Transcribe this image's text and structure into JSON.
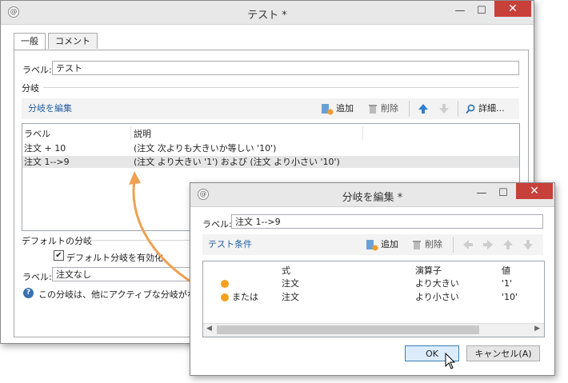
{
  "main": {
    "title": "テスト *",
    "tabs": [
      "一般",
      "コメント"
    ],
    "label_caption": "ラベル:",
    "label_value": "テスト",
    "branch_section": "分岐",
    "toolbar": {
      "edit_link": "分岐を編集",
      "add": "追加",
      "delete": "削除",
      "details": "詳細..."
    },
    "grid": {
      "columns": [
        "ラベル",
        "説明"
      ],
      "rows": [
        {
          "label": "注文 + 10",
          "desc": "(注文  次よりも大きいか等しい '10')"
        },
        {
          "label": "注文 1-->9",
          "desc": "(注文 より大きい '1') および (注文 より小さい '10')"
        }
      ]
    },
    "default_section": "デフォルトの分岐",
    "default_checkbox": "デフォルト分岐を有効化",
    "default_label_caption": "ラベル:",
    "default_label_value": "注文なし",
    "info_text": "この分岐は、他にアクティブな分岐がない"
  },
  "dialog": {
    "title": "分岐を編集 *",
    "label_caption": "ラベル:",
    "label_value": "注文 1-->9",
    "toolbar": {
      "test_link": "テスト条件",
      "add": "追加",
      "delete": "削除"
    },
    "grid": {
      "columns": [
        "式",
        "演算子",
        "値"
      ],
      "rows": [
        {
          "prefix": "",
          "expr": "注文",
          "op": "より大きい",
          "value": "'1'"
        },
        {
          "prefix": "または",
          "expr": "注文",
          "op": "より小さい",
          "value": "'10'"
        }
      ]
    },
    "ok_label": "OK",
    "cancel_label": "キャンセル(A)"
  },
  "colors": {
    "accent_orange": "#f0a050",
    "close_red": "#c7403a",
    "link_blue": "#1f5fa8",
    "up_arrow_blue": "#2d7fd4"
  }
}
